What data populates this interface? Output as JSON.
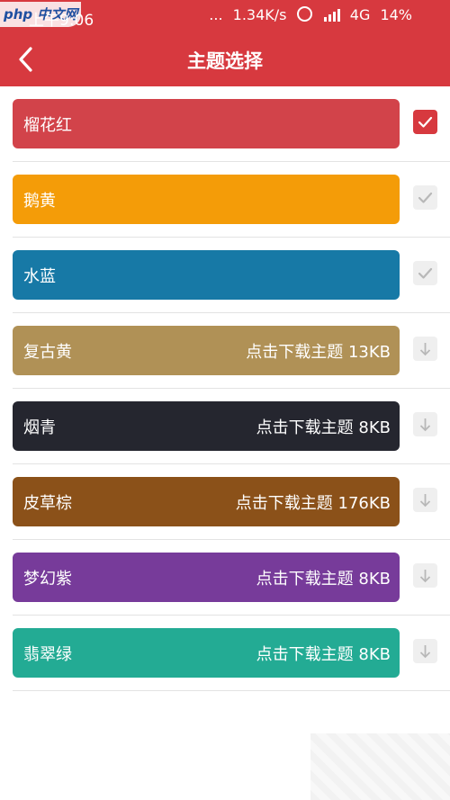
{
  "status_bar": {
    "logo": "php 中文网",
    "time": "上午9:06",
    "dots": "...",
    "speed": "1.34K/s",
    "icons": [
      "alarm-icon",
      "hd-signal-icon"
    ],
    "network": "4G",
    "battery": "14%"
  },
  "header": {
    "title": "主题选择",
    "back_icon": "chevron-left-icon",
    "background": "#d7393f"
  },
  "themes": [
    {
      "name": "榴花红",
      "download": "",
      "color": "#d2434a",
      "state": "selected"
    },
    {
      "name": "鹅黄",
      "download": "",
      "color": "#f49c08",
      "state": "installed"
    },
    {
      "name": "水蓝",
      "download": "",
      "color": "#1779a6",
      "state": "installed"
    },
    {
      "name": "复古黄",
      "download": "点击下载主题 13KB",
      "color": "#b09156",
      "state": "download"
    },
    {
      "name": "烟青",
      "download": "点击下载主题 8KB",
      "color": "#25262f",
      "state": "download"
    },
    {
      "name": "皮草棕",
      "download": "点击下载主题 176KB",
      "color": "#8b5119",
      "state": "download"
    },
    {
      "name": "梦幻紫",
      "download": "点击下载主题 8KB",
      "color": "#773b9a",
      "state": "download"
    },
    {
      "name": "翡翠绿",
      "download": "点击下载主题 8KB",
      "color": "#23ab94",
      "state": "download"
    }
  ]
}
